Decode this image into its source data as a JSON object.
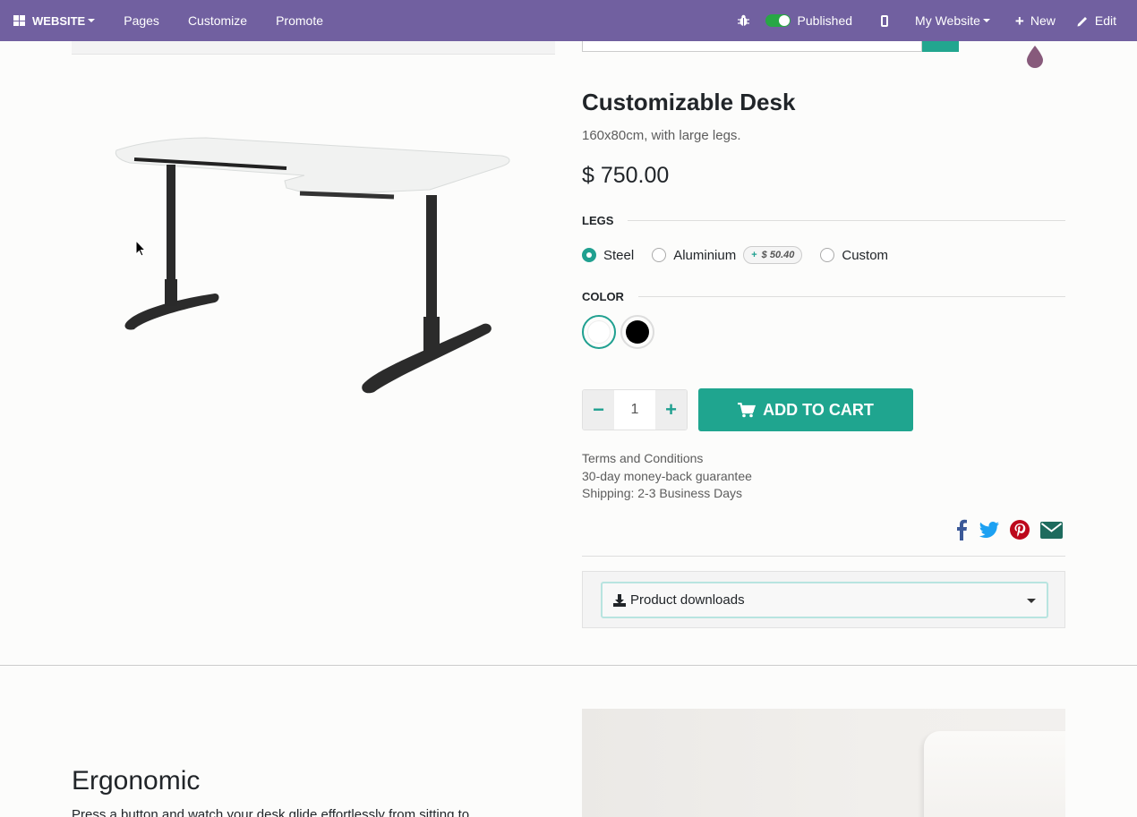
{
  "topbar": {
    "brand": "WEBSITE",
    "pages": "Pages",
    "customize": "Customize",
    "promote": "Promote",
    "published": "Published",
    "my_website": "My Website",
    "new": "New",
    "edit": "Edit"
  },
  "product": {
    "name": "Customizable Desk",
    "description": "160x80cm, with large legs.",
    "price": "$ 750.00"
  },
  "attributes": {
    "legs": {
      "title": "LEGS",
      "options": [
        {
          "label": "Steel",
          "selected": true
        },
        {
          "label": "Aluminium",
          "extra": "$ 50.40"
        },
        {
          "label": "Custom"
        }
      ]
    },
    "color": {
      "title": "COLOR",
      "options": [
        {
          "value": "#ffffff",
          "selected": true
        },
        {
          "value": "#000000"
        }
      ]
    }
  },
  "cart": {
    "quantity": "1",
    "add_label": "ADD TO CART"
  },
  "terms": {
    "line1": "Terms and Conditions",
    "line2": "30-day money-back guarantee",
    "line3": "Shipping: 2-3 Business Days"
  },
  "downloads": {
    "label": "Product downloads"
  },
  "section": {
    "title": "Ergonomic",
    "text": "Press a button and watch your desk glide effortlessly from sitting to"
  },
  "colors": {
    "topbar": "#7160a0",
    "accent": "#1fa58f"
  }
}
